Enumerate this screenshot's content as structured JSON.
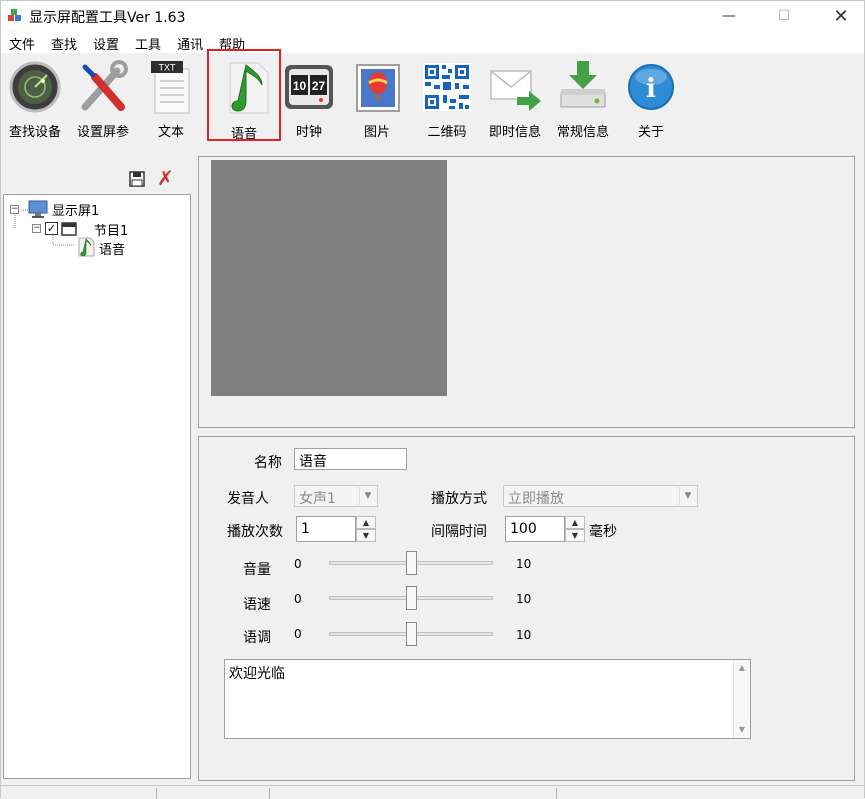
{
  "window": {
    "title": "显示屏配置工具Ver 1.63",
    "minimize_glyph": "—",
    "maximize_glyph": "☐",
    "close_glyph": "✕"
  },
  "menu": [
    "文件",
    "查找",
    "设置",
    "工具",
    "通讯",
    "帮助"
  ],
  "toolbar": {
    "selected": "语音",
    "buttons": [
      {
        "label": "查找设备",
        "icon": "radar-search-icon"
      },
      {
        "label": "设置屏参",
        "icon": "wrench-screwdriver-icon"
      },
      {
        "label": "文本",
        "icon": "text-document-icon",
        "badge": "TXT"
      },
      {
        "label": "语音",
        "icon": "music-note-icon"
      },
      {
        "label": "时钟",
        "icon": "flip-clock-icon",
        "digits": [
          "10",
          "27"
        ]
      },
      {
        "label": "图片",
        "icon": "picture-balloon-icon"
      },
      {
        "label": "二维码",
        "icon": "qr-code-icon"
      },
      {
        "label": "即时信息",
        "icon": "envelope-arrow-icon"
      },
      {
        "label": "常规信息",
        "icon": "download-disk-icon"
      },
      {
        "label": "关于",
        "icon": "info-icon",
        "glyph": "i"
      }
    ]
  },
  "tree": {
    "toolbar_icons": [
      "save-icon",
      "delete-icon"
    ],
    "delete_glyph": "✗",
    "nodes": {
      "screen": {
        "label": "显示屏1",
        "expander": "−"
      },
      "program": {
        "label": "节目1",
        "expander": "−",
        "checked": true,
        "check_glyph": "✓"
      },
      "voice": {
        "label": "语音"
      }
    }
  },
  "props": {
    "name_label": "名称",
    "name_value": "语音",
    "speaker_label": "发音人",
    "speaker_value": "女声1",
    "play_mode_label": "播放方式",
    "play_mode_value": "立即播放",
    "play_count_label": "播放次数",
    "play_count_value": "1",
    "interval_label": "间隔时间",
    "interval_value": "100",
    "interval_unit": "毫秒",
    "spin_up": "▲",
    "spin_down": "▼",
    "combo_arrow": "▼",
    "volume": {
      "label": "音量",
      "min": "0",
      "max": "10",
      "value": 5
    },
    "speed": {
      "label": "语速",
      "min": "0",
      "max": "10",
      "value": 5
    },
    "pitch": {
      "label": "语调",
      "min": "0",
      "max": "10",
      "value": 5
    },
    "text_content": "欢迎光临"
  }
}
